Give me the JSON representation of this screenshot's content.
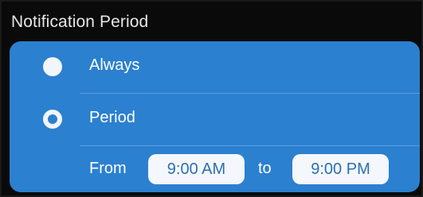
{
  "header": {
    "title": "Notification Period"
  },
  "options": [
    {
      "label": "Always",
      "selected": false
    },
    {
      "label": "Period",
      "selected": true
    }
  ],
  "period": {
    "from_label": "From",
    "start_time": "9:00 AM",
    "to_label": "to",
    "end_time": "9:00 PM"
  },
  "colors": {
    "background": "#0a0a0a",
    "card": "#2b80cf",
    "radio": "#f2f6fb",
    "pill_background": "#f4f7fb",
    "pill_text": "#2b6fb3",
    "text": "#ffffff"
  }
}
